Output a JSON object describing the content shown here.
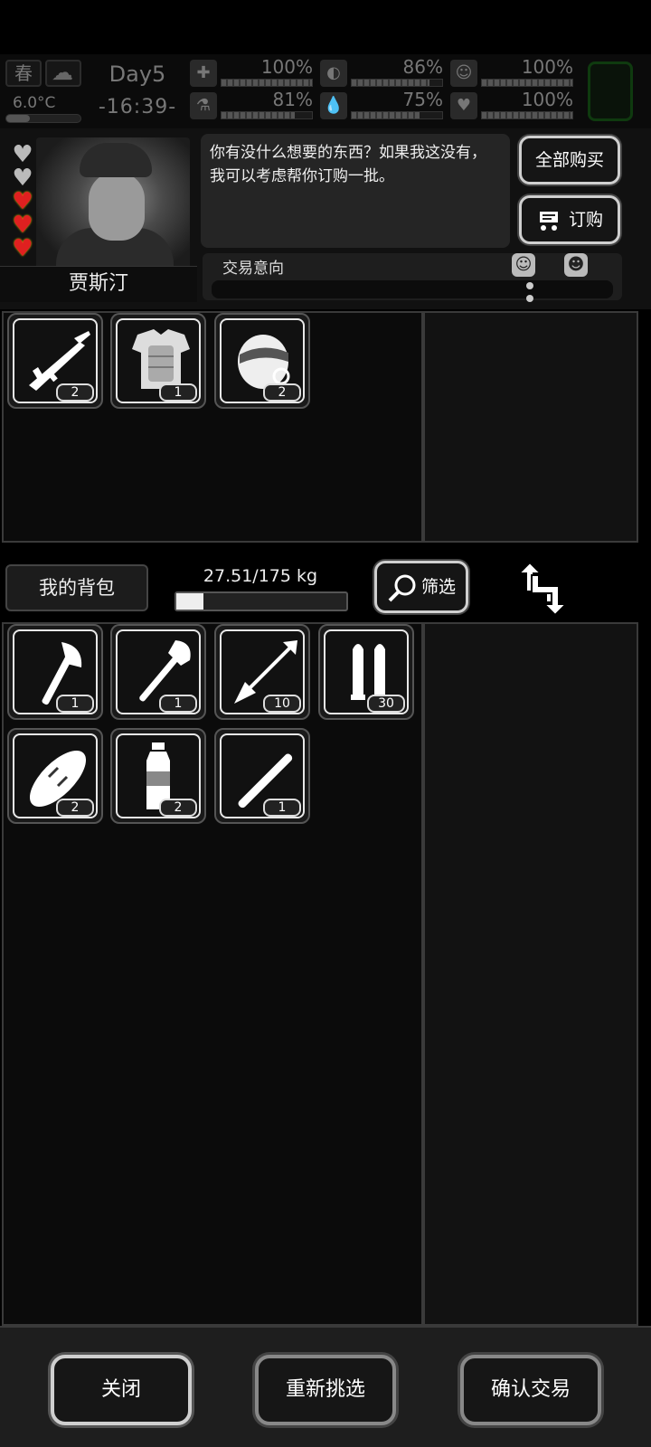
{
  "hud": {
    "season": "春",
    "temperature": "6.0°C",
    "day": "Day5",
    "time": "-16:39-",
    "stats": [
      {
        "icon": "first-aid-icon",
        "value": "100%",
        "level": 1.0
      },
      {
        "icon": "stomach-icon",
        "value": "86%",
        "level": 0.86
      },
      {
        "icon": "mood-icon",
        "value": "100%",
        "level": 1.0
      },
      {
        "icon": "stamina-icon",
        "value": "81%",
        "level": 0.81
      },
      {
        "icon": "water-drop-icon",
        "value": "75%",
        "level": 0.75
      },
      {
        "icon": "heart-health-icon",
        "value": "100%",
        "level": 1.0
      }
    ]
  },
  "merchant": {
    "name": "贾斯汀",
    "hearts_total": 5,
    "hearts_filled": 3,
    "dialog": "你有没什么想要的东西？如果我这没有，我可以考虑帮你订购一批。",
    "buy_all_label": "全部购买",
    "order_label": "订购",
    "trade_intent_label": "交易意向"
  },
  "merchant_items": [
    {
      "name": "rifle-icon",
      "count": "2"
    },
    {
      "name": "body-armor-icon",
      "count": "1"
    },
    {
      "name": "helmet-icon",
      "count": "2"
    }
  ],
  "inventory": {
    "title": "我的背包",
    "weight": "27.51/175 kg",
    "weight_fraction": 0.157,
    "filter_label": "筛选"
  },
  "my_items": [
    {
      "name": "axe-icon",
      "count": "1"
    },
    {
      "name": "shovel-icon",
      "count": "1"
    },
    {
      "name": "arrow-icon",
      "count": "10"
    },
    {
      "name": "bullets-icon",
      "count": "30"
    },
    {
      "name": "bread-icon",
      "count": "2"
    },
    {
      "name": "water-bottle-icon",
      "count": "2"
    },
    {
      "name": "stick-icon",
      "count": "1"
    }
  ],
  "actions": {
    "close": "关闭",
    "reselect": "重新挑选",
    "confirm": "确认交易"
  }
}
